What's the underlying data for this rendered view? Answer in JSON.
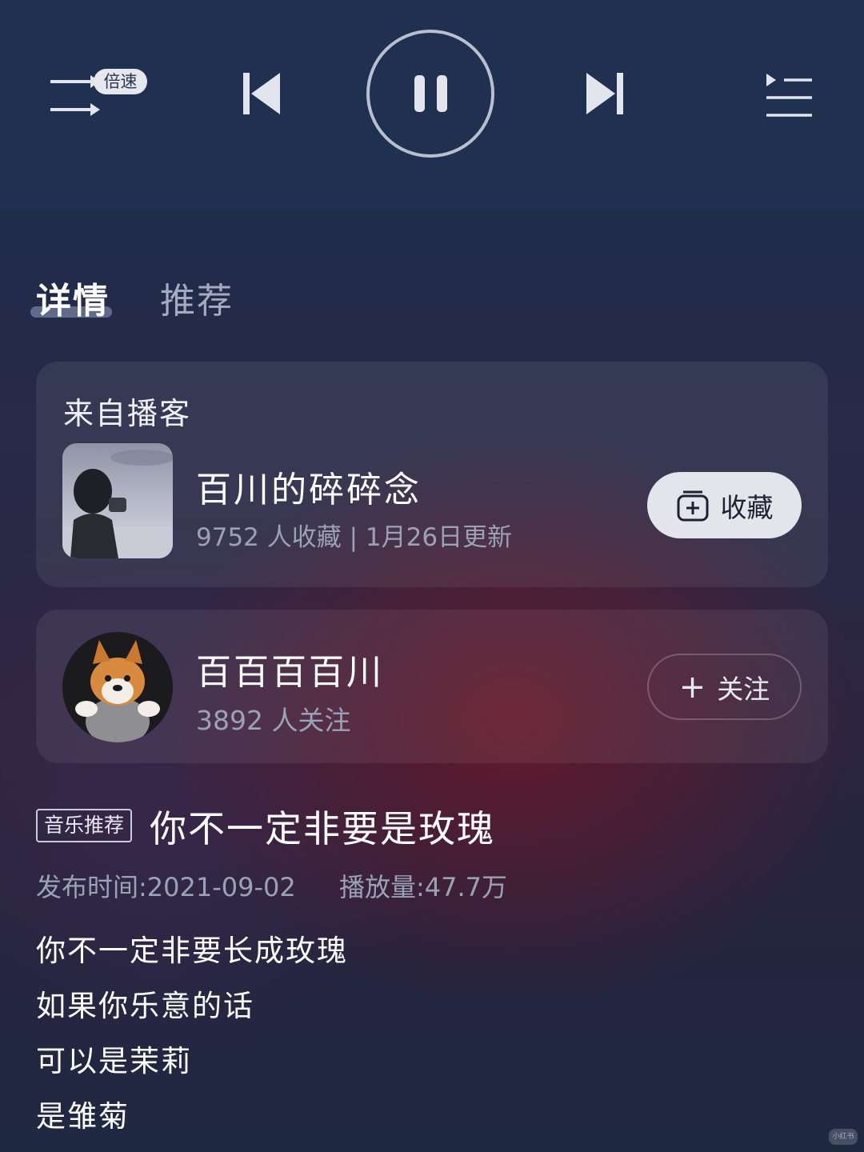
{
  "player_controls": {
    "speed_label": "倍速",
    "icons": {
      "mode": "shuffle-arrows-icon",
      "prev": "skip-previous-icon",
      "play_state": "pause-icon",
      "next": "skip-next-icon",
      "playlist": "playlist-icon"
    }
  },
  "tabs": [
    {
      "label": "详情",
      "active": true
    },
    {
      "label": "推荐",
      "active": false
    }
  ],
  "podcast_card": {
    "section_title": "来自播客",
    "name": "百川的碎碎念",
    "meta": "9752 人收藏 | 1月26日更新",
    "collect_label": "收藏",
    "collect_icon": "add-to-collection-icon"
  },
  "author_card": {
    "name": "百百百百川",
    "meta": "3892 人关注",
    "follow_label": "关注",
    "follow_icon": "plus-icon"
  },
  "episode": {
    "tag": "音乐推荐",
    "title": "你不一定非要是玫瑰",
    "publish_time": "发布时间:2021-09-02",
    "plays": "播放量:47.7万",
    "lyrics": [
      "你不一定非要长成玫瑰",
      "如果你乐意的话",
      "可以是茉莉",
      "是雏菊"
    ]
  },
  "watermark": "小红书",
  "colors": {
    "control_bar_bg": "#1f3050",
    "icon": "#e2e5ec",
    "secondary_text": "#9aa2b6",
    "collect_button_bg": "#e3e5eb"
  }
}
